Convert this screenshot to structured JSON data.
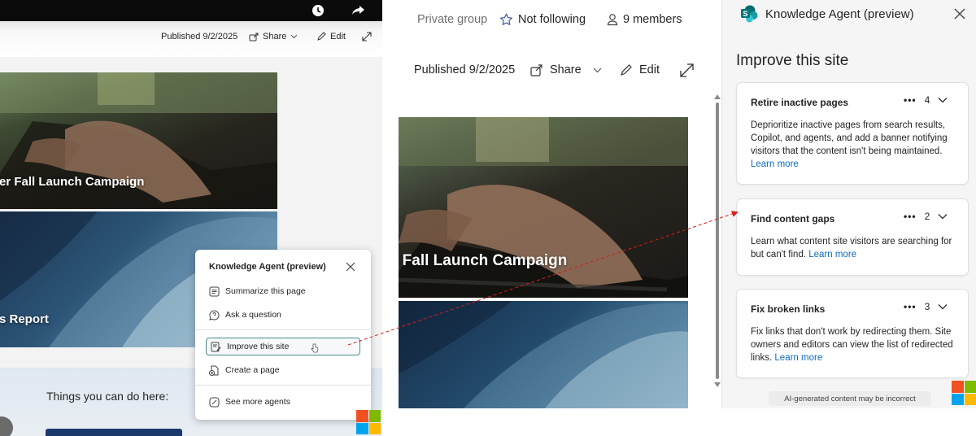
{
  "left": {
    "published": "Published 9/2/2025",
    "share": "Share",
    "edit": "Edit",
    "hero1_title": "er Fall Launch Campaign",
    "hero2_title": "s Report",
    "things_title": "Things you can do here:",
    "popup": {
      "title": "Knowledge Agent (preview)",
      "items": [
        {
          "label": "Summarize this page",
          "icon": "summarize-icon"
        },
        {
          "label": "Ask a question",
          "icon": "chat-question-icon"
        },
        {
          "label": "Improve this site",
          "icon": "improve-site-icon"
        },
        {
          "label": "Create a page",
          "icon": "create-page-icon"
        },
        {
          "label": "See more agents",
          "icon": "agents-icon"
        }
      ]
    }
  },
  "middle": {
    "privacy": "Private group",
    "following": "Not following",
    "members": "9 members",
    "published": "Published 9/2/2025",
    "share": "Share",
    "edit": "Edit",
    "hero_title": "r Fall Launch Campaign"
  },
  "right": {
    "title": "Knowledge Agent (preview)",
    "heading": "Improve this site",
    "cards": [
      {
        "title": "Retire inactive pages",
        "count": "4",
        "body": "Deprioritize inactive pages from search results, Copilot, and agents, and add a banner notifying visitors that the content isn't being maintained.",
        "link": "Learn more"
      },
      {
        "title": "Find content gaps",
        "count": "2",
        "body": "Learn what content site visitors are searching for but can't find.",
        "link": "Learn more"
      },
      {
        "title": "Fix broken links",
        "count": "3",
        "body": "Fix links that don't work by redirecting them. Site owners and editors can view the list of redirected links.",
        "link": "Learn more"
      }
    ],
    "disclaimer": "AI-generated content may be incorrect"
  },
  "colors": {
    "accent": "#0f6cbd",
    "selected_border": "#4b8a8d",
    "arrow": "#d81e1e"
  }
}
